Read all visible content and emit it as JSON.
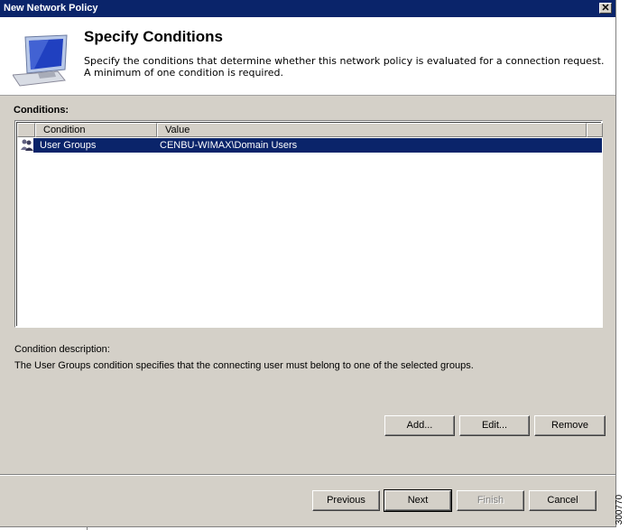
{
  "window": {
    "title": "New Network Policy"
  },
  "header": {
    "title": "Specify Conditions",
    "description": "Specify the conditions that determine whether this network policy is evaluated for a connection request. A minimum of one condition is required.",
    "icon": "monitor-icon"
  },
  "conditions": {
    "label": "Conditions:",
    "columns": [
      "Condition",
      "Value"
    ],
    "rows": [
      {
        "condition": "User Groups",
        "value": "CENBU-WIMAX\\Domain Users",
        "icon": "user-group-icon",
        "selected": true
      }
    ]
  },
  "condition_description": {
    "label": "Condition description:",
    "text": "The User Groups condition specifies that the connecting user must belong to one of the selected groups."
  },
  "actions": {
    "add": "Add...",
    "edit": "Edit...",
    "remove": "Remove"
  },
  "footer": {
    "previous": "Previous",
    "next": "Next",
    "finish": "Finish",
    "cancel": "Cancel"
  },
  "figure_id": "300770",
  "colors": {
    "titlebar": "#0a246a",
    "selection": "#0a246a",
    "dialog_bg": "#d4d0c8"
  }
}
